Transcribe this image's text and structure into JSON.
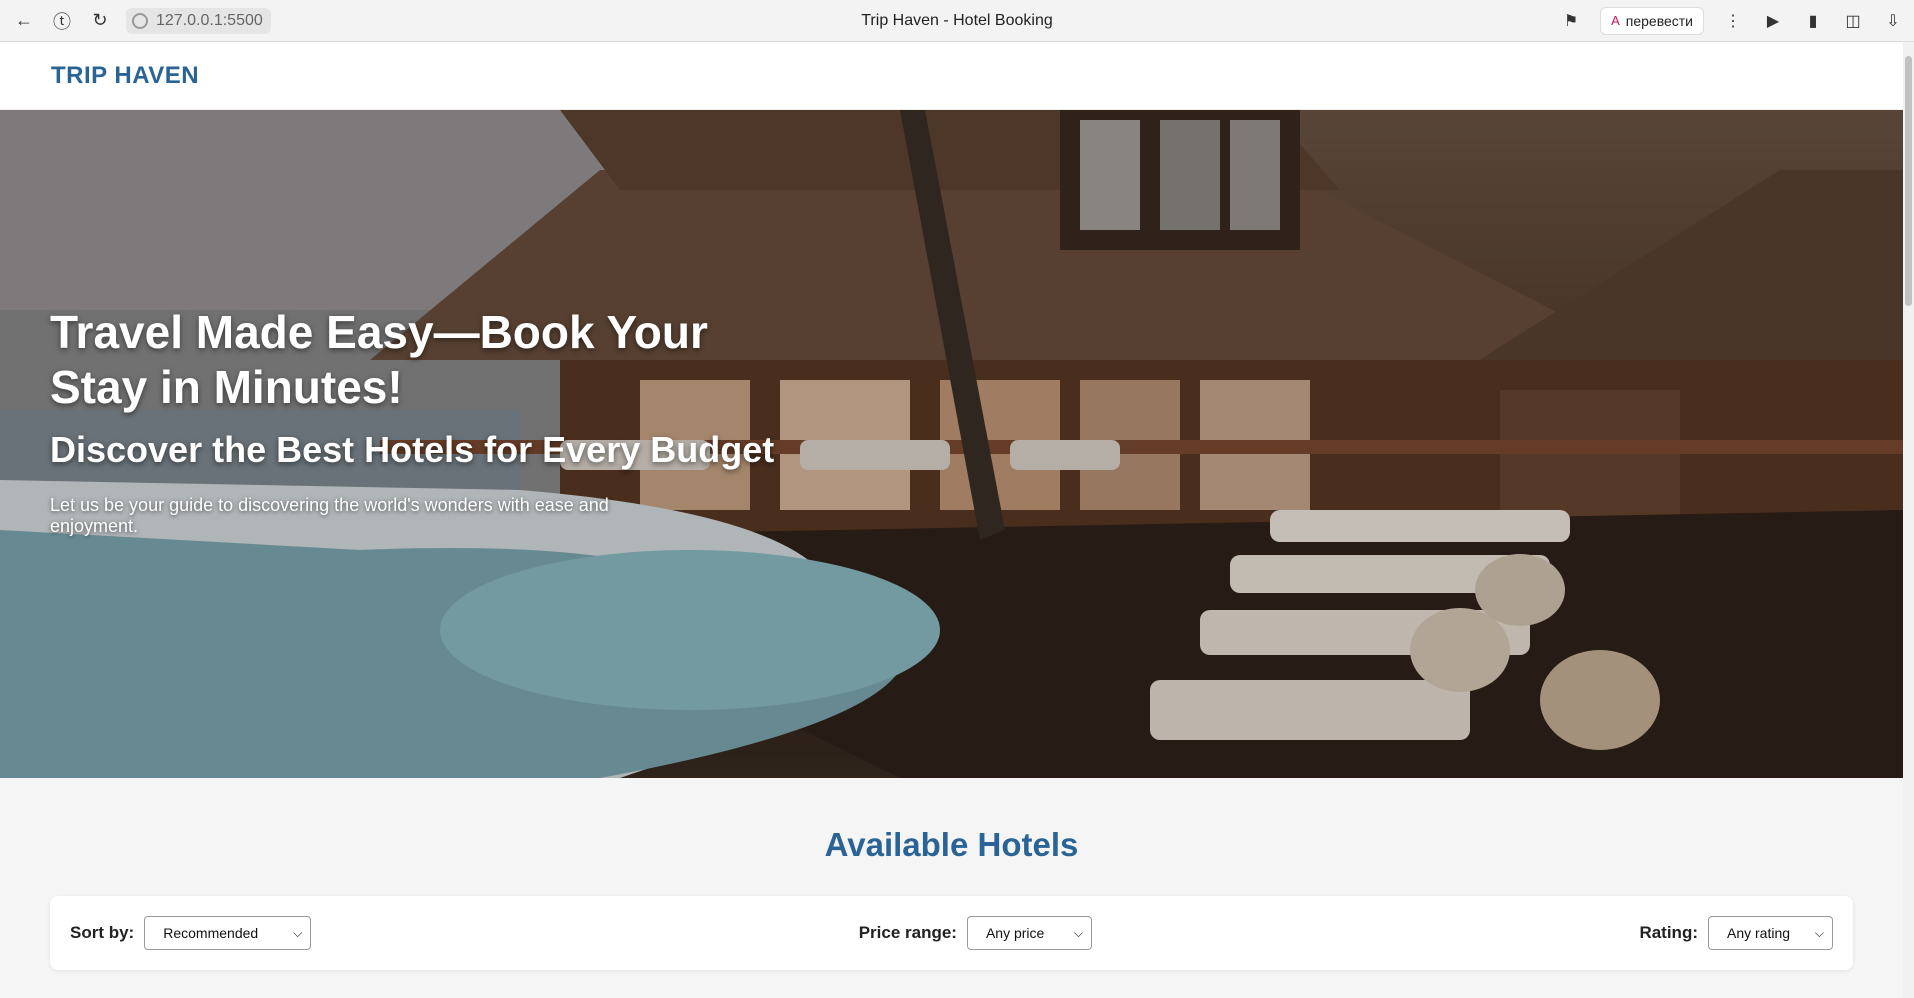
{
  "browser": {
    "url": "127.0.0.1:5500",
    "tab_title": "Trip Haven - Hotel Booking",
    "translate_label": "перевести"
  },
  "header": {
    "logo": "TRIP HAVEN"
  },
  "hero": {
    "title": "Travel Made Easy—Book Your Stay in Minutes!",
    "subtitle": "Discover the Best Hotels for Every Budget",
    "description": "Let us be your guide to discovering the world's wonders with ease and enjoyment."
  },
  "hotels": {
    "section_title": "Available Hotels",
    "filters": {
      "sort_label": "Sort by:",
      "sort_value": "Recommended",
      "price_label": "Price range:",
      "price_value": "Any price",
      "rating_label": "Rating:",
      "rating_value": "Any rating"
    }
  }
}
